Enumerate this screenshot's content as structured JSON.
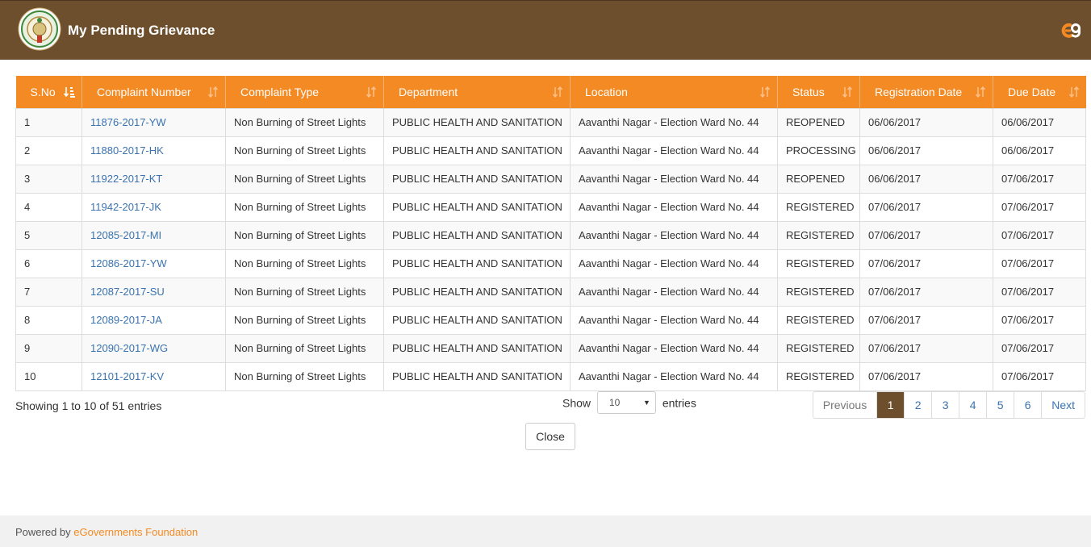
{
  "header": {
    "title": "My Pending Grievance"
  },
  "table": {
    "columns": [
      "S.No",
      "Complaint Number",
      "Complaint Type",
      "Department",
      "Location",
      "Status",
      "Registration Date",
      "Due Date"
    ],
    "rows": [
      [
        "1",
        "11876-2017-YW",
        "Non Burning of Street Lights",
        "PUBLIC HEALTH AND SANITATION",
        "Aavanthi Nagar - Election Ward No. 44",
        "REOPENED",
        "06/06/2017",
        "06/06/2017"
      ],
      [
        "2",
        "11880-2017-HK",
        "Non Burning of Street Lights",
        "PUBLIC HEALTH AND SANITATION",
        "Aavanthi Nagar - Election Ward No. 44",
        "PROCESSING",
        "06/06/2017",
        "06/06/2017"
      ],
      [
        "3",
        "11922-2017-KT",
        "Non Burning of Street Lights",
        "PUBLIC HEALTH AND SANITATION",
        "Aavanthi Nagar - Election Ward No. 44",
        "REOPENED",
        "06/06/2017",
        "07/06/2017"
      ],
      [
        "4",
        "11942-2017-JK",
        "Non Burning of Street Lights",
        "PUBLIC HEALTH AND SANITATION",
        "Aavanthi Nagar - Election Ward No. 44",
        "REGISTERED",
        "07/06/2017",
        "07/06/2017"
      ],
      [
        "5",
        "12085-2017-MI",
        "Non Burning of Street Lights",
        "PUBLIC HEALTH AND SANITATION",
        "Aavanthi Nagar - Election Ward No. 44",
        "REGISTERED",
        "07/06/2017",
        "07/06/2017"
      ],
      [
        "6",
        "12086-2017-YW",
        "Non Burning of Street Lights",
        "PUBLIC HEALTH AND SANITATION",
        "Aavanthi Nagar - Election Ward No. 44",
        "REGISTERED",
        "07/06/2017",
        "07/06/2017"
      ],
      [
        "7",
        "12087-2017-SU",
        "Non Burning of Street Lights",
        "PUBLIC HEALTH AND SANITATION",
        "Aavanthi Nagar - Election Ward No. 44",
        "REGISTERED",
        "07/06/2017",
        "07/06/2017"
      ],
      [
        "8",
        "12089-2017-JA",
        "Non Burning of Street Lights",
        "PUBLIC HEALTH AND SANITATION",
        "Aavanthi Nagar - Election Ward No. 44",
        "REGISTERED",
        "07/06/2017",
        "07/06/2017"
      ],
      [
        "9",
        "12090-2017-WG",
        "Non Burning of Street Lights",
        "PUBLIC HEALTH AND SANITATION",
        "Aavanthi Nagar - Election Ward No. 44",
        "REGISTERED",
        "07/06/2017",
        "07/06/2017"
      ],
      [
        "10",
        "12101-2017-KV",
        "Non Burning of Street Lights",
        "PUBLIC HEALTH AND SANITATION",
        "Aavanthi Nagar - Election Ward No. 44",
        "REGISTERED",
        "07/06/2017",
        "07/06/2017"
      ]
    ]
  },
  "info": "Showing 1 to 10 of 51 entries",
  "length": {
    "prefix": "Show",
    "value": "10",
    "suffix": "entries"
  },
  "pagination": {
    "previous": "Previous",
    "pages": [
      "1",
      "2",
      "3",
      "4",
      "5",
      "6"
    ],
    "active": "1",
    "next": "Next"
  },
  "close_label": "Close",
  "footer": {
    "prefix": "Powered by",
    "link": "eGovernments Foundation"
  },
  "colors": {
    "header_bg": "#6e4f2d",
    "table_header_bg": "#f48a23",
    "link": "#3a73b0",
    "accent": "#f48a23"
  }
}
